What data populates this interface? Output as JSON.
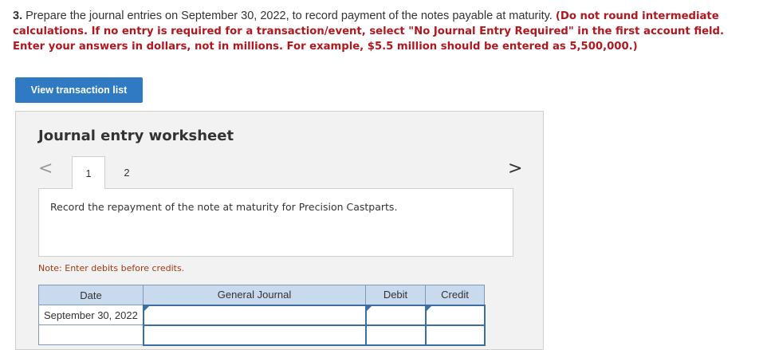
{
  "question": {
    "number": "3.",
    "text": " Prepare the journal entries on September 30, 2022, to record payment of the notes payable at maturity. ",
    "instructions": "(Do not round intermediate calculations. If no entry is required for a transaction/event, select \"No Journal Entry Required\" in the first account field. Enter your answers in dollars, not in millions. For example, $5.5 million should be entered as 5,500,000.)"
  },
  "view_button_label": "View transaction list",
  "worksheet": {
    "title": "Journal entry worksheet",
    "prev_icon": "<",
    "next_icon": ">",
    "tabs": [
      "1",
      "2"
    ],
    "record_text": "Record the repayment of the note at maturity for Precision Castparts.",
    "note": "Note: Enter debits before credits.",
    "table": {
      "headers": [
        "Date",
        "General Journal",
        "Debit",
        "Credit"
      ],
      "rows": [
        {
          "date": "September 30, 2022",
          "account": "",
          "debit": "",
          "credit": ""
        },
        {
          "date": "",
          "account": "",
          "debit": "",
          "credit": ""
        }
      ]
    }
  },
  "colors": {
    "instruction_red": "#b0171f",
    "button_blue": "#2f7ac2",
    "header_blue": "#c9d9ee"
  }
}
